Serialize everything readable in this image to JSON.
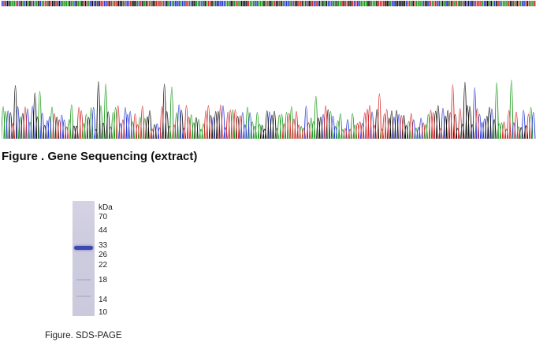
{
  "sequencing": {
    "caption": "Figure . Gene Sequencing (extract)"
  },
  "gel": {
    "unit_label": "kDa",
    "markers": [
      "70",
      "44",
      "33",
      "26",
      "22",
      "18",
      "14",
      "10"
    ],
    "caption": "Figure. SDS-PAGE"
  },
  "colors": {
    "base_A": "#1f9a1f",
    "base_C": "#2a3ad6",
    "base_G": "#111111",
    "base_T": "#d42a2a",
    "band": "#3d49b0"
  }
}
